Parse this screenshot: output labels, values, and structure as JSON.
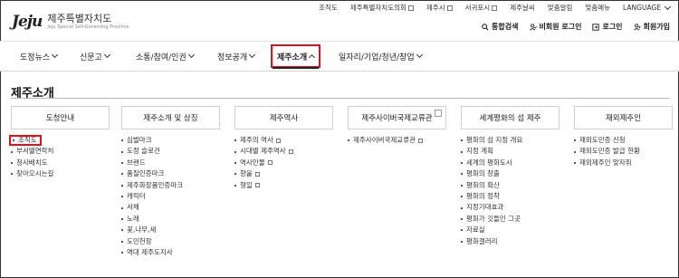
{
  "top_links": [
    {
      "label": "조직도",
      "ext": false
    },
    {
      "label": "제주특별자치도의회",
      "ext": true
    },
    {
      "label": "제주시",
      "ext": true
    },
    {
      "label": "서귀포시",
      "ext": true
    },
    {
      "label": "제주날씨",
      "ext": false
    },
    {
      "label": "맞춤알림",
      "ext": false
    },
    {
      "label": "맞춤메뉴",
      "ext": false
    },
    {
      "label": "LANGUAGE",
      "ext": false
    }
  ],
  "logo": {
    "mark": "Jeju",
    "korean": "제주특별자치도",
    "english": "Jeju Special Self-Governing Province"
  },
  "utility": {
    "search": "통합검색",
    "cert": "비회원 로그인",
    "login": "로그인",
    "join": "회원가입"
  },
  "gnb": [
    "도정뉴스",
    "신문고",
    "소통/참여/인권",
    "정보공개",
    "제주소개",
    "일자리/기업/청년/창업"
  ],
  "page_title": "제주소개",
  "columns": [
    {
      "title": "도청안내",
      "copy_icon": false,
      "items": [
        {
          "label": "조직도",
          "ext": false
        },
        {
          "label": "부서별연락처",
          "ext": false
        },
        {
          "label": "청사배치도",
          "ext": false
        },
        {
          "label": "찾아오시는길",
          "ext": false
        }
      ]
    },
    {
      "title": "제주소개 및 상징",
      "copy_icon": false,
      "items": [
        {
          "label": "심벌마크",
          "ext": false
        },
        {
          "label": "도정 슬로건",
          "ext": false
        },
        {
          "label": "브랜드",
          "ext": false
        },
        {
          "label": "품질인증마크",
          "ext": false
        },
        {
          "label": "제주화장품인증마크",
          "ext": false
        },
        {
          "label": "캐릭터",
          "ext": false
        },
        {
          "label": "서체",
          "ext": false
        },
        {
          "label": "노래",
          "ext": false
        },
        {
          "label": "꽃,나무,새",
          "ext": false
        },
        {
          "label": "도민헌장",
          "ext": false
        },
        {
          "label": "역대 제주도지사",
          "ext": false
        }
      ]
    },
    {
      "title": "제주역사",
      "copy_icon": false,
      "items": [
        {
          "label": "제주의 역사",
          "ext": true
        },
        {
          "label": "시대별 제주역사",
          "ext": true
        },
        {
          "label": "역사인물",
          "ext": true
        },
        {
          "label": "향울",
          "ext": true
        },
        {
          "label": "형일",
          "ext": true
        }
      ]
    },
    {
      "title": "제주사이버국제교류관",
      "copy_icon": true,
      "items": [
        {
          "label": "제주사이버국제교류관",
          "ext": true
        }
      ]
    },
    {
      "title": "세계평화의 섬 제주",
      "copy_icon": false,
      "items": [
        {
          "label": "평화의 섬 지정 개요",
          "ext": false
        },
        {
          "label": "지정 계획",
          "ext": false
        },
        {
          "label": "세계의 평화도시",
          "ext": false
        },
        {
          "label": "평화의 창출",
          "ext": false
        },
        {
          "label": "평화의 확산",
          "ext": false
        },
        {
          "label": "평화의 정착",
          "ext": false
        },
        {
          "label": "지정기대효과",
          "ext": false
        },
        {
          "label": "평화가 깃들인 그곳",
          "ext": false
        },
        {
          "label": "자료실",
          "ext": false
        },
        {
          "label": "평화갤러리",
          "ext": false
        }
      ]
    },
    {
      "title": "재외제주인",
      "copy_icon": false,
      "items": [
        {
          "label": "재외도민증 신청",
          "ext": false
        },
        {
          "label": "재외도민증 발급 현황",
          "ext": false
        },
        {
          "label": "재외제주인 맞자취",
          "ext": false
        }
      ]
    }
  ]
}
